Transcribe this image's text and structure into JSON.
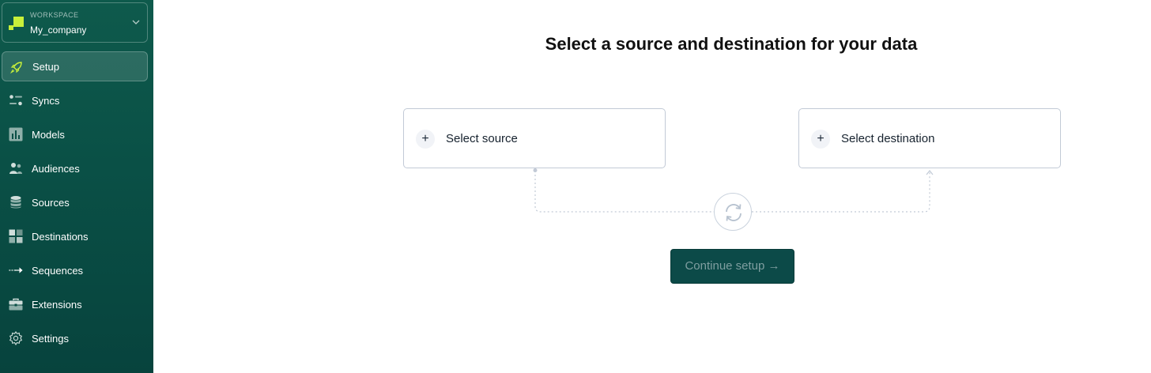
{
  "workspace": {
    "label": "WORKSPACE",
    "name": "My_company",
    "logo_color": "#c8f03a"
  },
  "sidebar": {
    "items": [
      {
        "label": "Setup",
        "icon": "rocket-icon",
        "active": true
      },
      {
        "label": "Syncs",
        "icon": "syncs-icon"
      },
      {
        "label": "Models",
        "icon": "bar-chart-icon"
      },
      {
        "label": "Audiences",
        "icon": "users-icon"
      },
      {
        "label": "Sources",
        "icon": "database-icon"
      },
      {
        "label": "Destinations",
        "icon": "grid-icon"
      },
      {
        "label": "Sequences",
        "icon": "sequence-icon"
      },
      {
        "label": "Extensions",
        "icon": "toolbox-icon"
      },
      {
        "label": "Settings",
        "icon": "gear-icon"
      }
    ]
  },
  "main": {
    "title": "Select a source and destination for your data",
    "source_card": {
      "label": "Select source",
      "icon": "plus-icon"
    },
    "destination_card": {
      "label": "Select destination",
      "icon": "plus-icon"
    },
    "sync_icon": "sync-icon",
    "continue_button": "Continue setup →"
  },
  "colors": {
    "sidebar_bg": "#0a5046",
    "accent": "#c8f03a",
    "button_bg": "#0c4a48",
    "card_border": "#c2cad6"
  }
}
